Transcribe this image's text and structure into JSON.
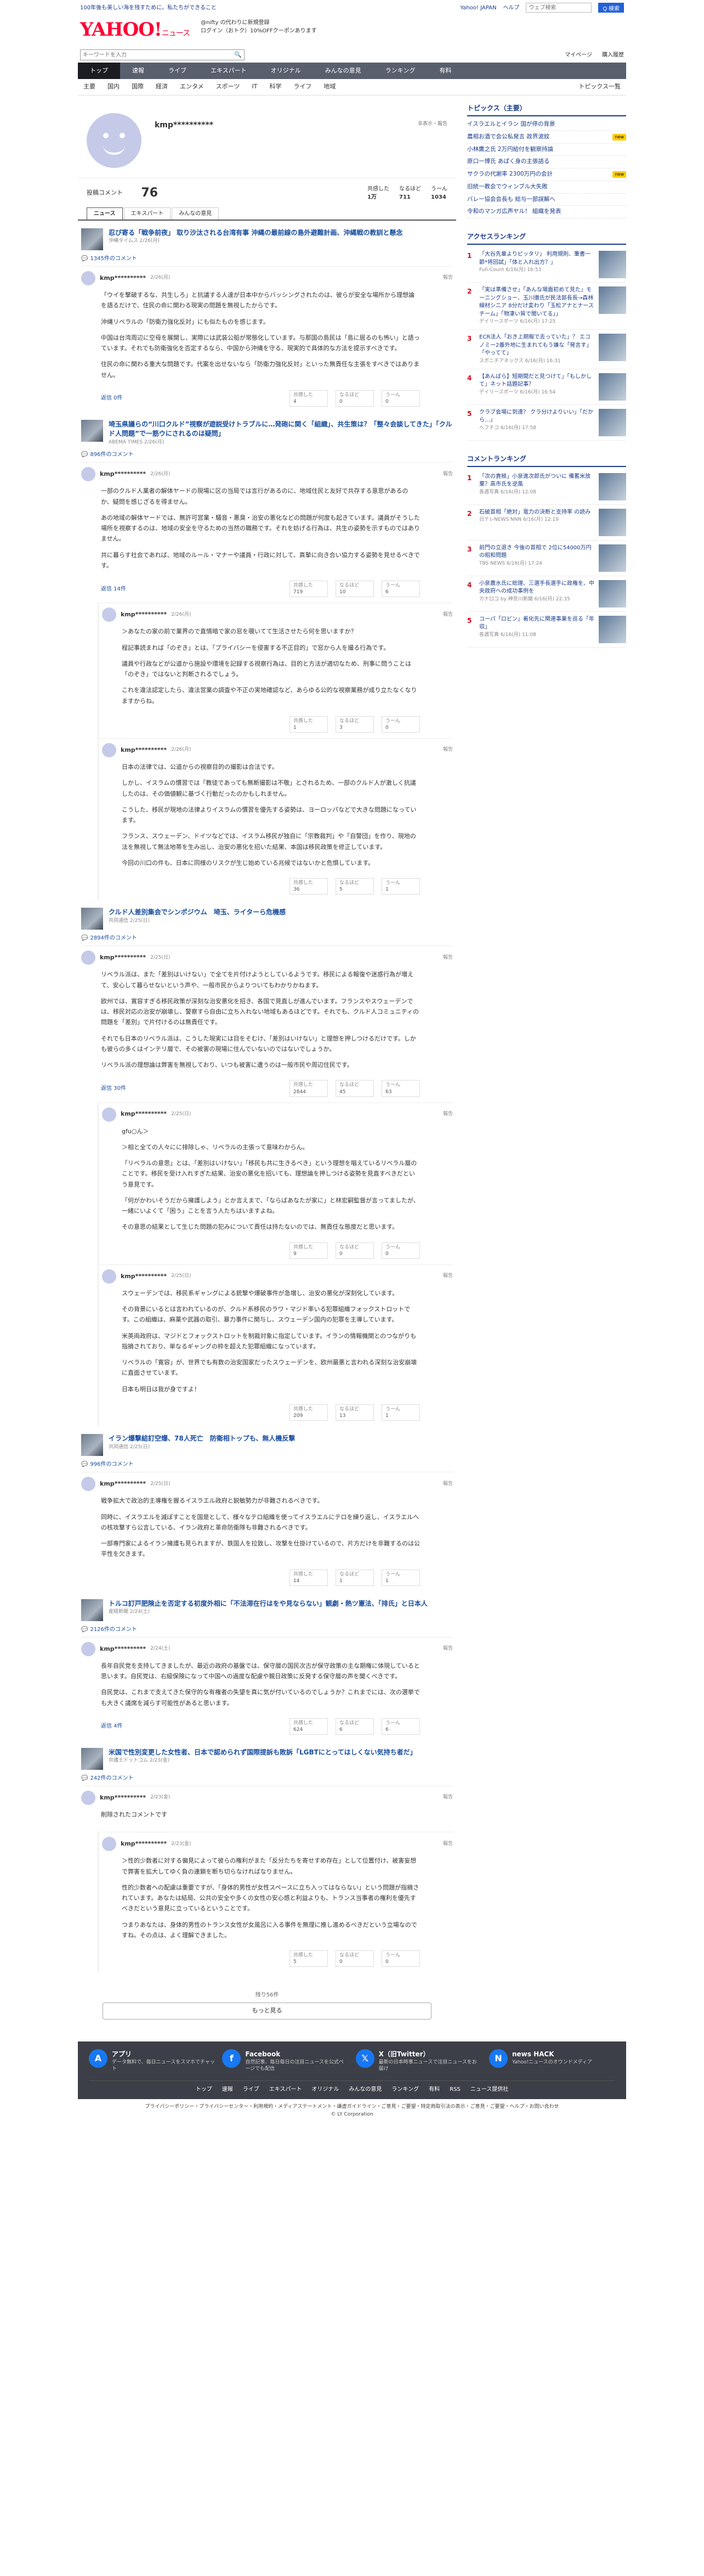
{
  "topline": {
    "left": "100年後も美しい海を残すために。私たちができること",
    "links": [
      "Yahoo! JAPAN",
      "ヘルプ"
    ],
    "search_placeholder": "ウェブ検索",
    "search_label": "Q 検索"
  },
  "logo": {
    "brand": "YAHOO!",
    "service": "ニュース",
    "sub": "JAPAN"
  },
  "promo": {
    "line1": "@nifty の代わりに新規登録",
    "line2": "ログイン（おトク）10%OFFクーポンあります"
  },
  "search": {
    "placeholder": "キーワードを入力",
    "right": [
      "マイページ",
      "購入履歴"
    ]
  },
  "nav": [
    "トップ",
    "速報",
    "ライブ",
    "エキスパート",
    "オリジナル",
    "みんなの意見",
    "ランキング",
    "有料"
  ],
  "subnav": {
    "cats": [
      "主要",
      "国内",
      "国際",
      "経済",
      "エンタメ",
      "スポーツ",
      "IT",
      "科学",
      "ライフ",
      "地域"
    ],
    "right": "トピックス一覧"
  },
  "profile": {
    "name": "kmp**********",
    "action": "非表示・報告",
    "label": "投稿コメント",
    "count": "76",
    "stats": [
      {
        "label": "共感した",
        "value": "1万"
      },
      {
        "label": "なるほど",
        "value": "711"
      },
      {
        "label": "うーん",
        "value": "1034"
      }
    ],
    "tabs": [
      "ニュース",
      "エキスパート",
      "みんなの意見"
    ]
  },
  "articles": [
    {
      "title": "忍び寄る「戦争前夜」 取り沙汰される台湾有事 沖縄の最前線の島外避難計画、沖縄戦の教訓と懸念",
      "source": "沖縄タイムス 2/26(月)",
      "count": "1345件のコメント",
      "comments": [
        {
          "user": "kmp**********",
          "time": "2/26(月)",
          "report": "報告",
          "paras": [
            "「ウイを撃破するな、共生しろ」と抗議する人達が日本中からバッシングされたのは、彼らが安全な場所から理想論を語るだけで、住民の命に関わる現実の問題を無視したからです。",
            "沖縄リベラルの「防衛力強化反対」にも似たものを感じます。",
            "中国は台湾周辺に空母を展開し、実際には武装公船が常態化しています。与那国の島民は「島に居るのも怖い」と語っています。それでも防衛強化を否定するなら、中国から沖縄を守る、現実的で具体的な方法を提示すべきです。",
            "住民の命に関わる重大な問題です。代案を出せないなら「防衛力強化反対」といった無責任な主張をすべきではありません。"
          ],
          "reply": "返信 0件",
          "reacts": [
            "4",
            "0",
            "0"
          ]
        }
      ]
    },
    {
      "title": "埼玉県議らの“川口クルド”視察が遊説受けトラブルに…発砲に関く「組織」、共生策は？「整々会談してきた」「クルド人問題”で一筋ウにされるのは疑問」",
      "source": "ABEMA TIMES 2/26(月)",
      "count": "896件のコメント",
      "comments": [
        {
          "user": "kmp**********",
          "time": "2/26(月)",
          "report": "報告",
          "paras": [
            "一部のクルド人業者の解体ヤードの現場に区の当局では言行があるのに、地域住民と友好で共存する意思があるのか、疑問を感じざるを得ません。",
            "あの地域の解体ヤードでは、無許可営業・騒音・悪臭・治安の悪化などの問題が何度も起きています。議員がそうした場所を視察するのは、地域の安全を守るための当然の職務です。それを妨げる行為は、共生の姿勢を示すものではありません。",
            "共に暮らす社会であれば、地域のルール・マナーや議員・行政に対して、真摯に向き合い協力する姿勢を見せるべきです。"
          ],
          "reply": "返信 14件",
          "reacts": [
            "719",
            "10",
            "6"
          ]
        },
        {
          "user": "kmp**********",
          "time": "2/26(月)",
          "report": "報告",
          "sub": true,
          "paras": [
            "＞あなたの家の前で業界ので直情暗で家の窓を覗いてて生活させたら何を思いますか？",
            "程記事読まれば「のぞき」とは、「プライバシーを侵害する不正目的」で窓から人を撮る行為です。",
            "議員や行政などが公道から施設や環境を記録する視察行為は、目的と方法が適切なため、刑事に問うことは「のぞき」ではないと判断されるでしょう。",
            "これを違法認定したら、違法営業の調査や不正の実地確認など、あらゆる公的な視察業務が成り立たなくなりますからね。"
          ],
          "reacts": [
            "1",
            "3",
            "0"
          ]
        },
        {
          "user": "kmp**********",
          "time": "2/26(月)",
          "report": "報告",
          "sub": true,
          "paras": [
            "日本の法律では、公道からの視察目的の撮影は合法です。",
            "しかし、イスラムの慣習では「教徒であっても無断撮影は不敬」とされるため、一部のクルド人が激しく抗議したのは、その価値観に基づく行動だったのかもしれません。",
            "こうした、移民が現地の法律よりイスラムの慣習を優先する姿勢は、ヨーロッパなどで大きな問題になっています。",
            "フランス、スウェーデン、ドイツなどでは、イスラム移民が独自に「宗教裁判」や「自警団」を作り、現地の法を無視して無法地帯を生み出し、治安の悪化を招いた結果、本国は移民政策を修正しています。",
            "今回の川口の件も、日本に同様のリスクが生じ始めている兆候ではないかと危惧しています。"
          ],
          "reacts": [
            "36",
            "5",
            "1"
          ]
        }
      ]
    },
    {
      "title": "クルド人差別集会でシンポジウム　埼玉、ライターら危機感",
      "source": "共同通信 2/25(日)",
      "count": "2894件のコメント",
      "comments": [
        {
          "user": "kmp**********",
          "time": "2/25(日)",
          "report": "報告",
          "paras": [
            "リベラル派は、また「差別はいけない」で全てを片付けようとしているようです。移民による報復や迷惑行為が増えて、安心して暮らせないという声や、一般市民からよりついてもわかりかねます。",
            "欧州では、寛容すぎる移民政策が深刻な治安悪化を招き、各国で見直しが進んでいます。フランスやスウェーデンでは、移民対応の治安が崩壊し、警察すら自由に立ち入れない地域もあるほどです。それでも、クルド人コミュニティの問題を「差別」で片付けるのは無責任です。",
            "それでも日本のリベラル派は、こうした現実には目をそむけ、「差別はいけない」と理想を押しつけるだけです。しかも彼らの多くはインテリ層で、その被害の現場に住んでいないのではないでしょうか。",
            "リベラル派の理想論は弊害を無視しており、いつも被害に遭うのは一般市民や周辺住民です。"
          ],
          "reply": "返信 30件",
          "reacts": [
            "2844",
            "45",
            "63"
          ]
        },
        {
          "user": "kmp**********",
          "time": "2/25(日)",
          "report": "報告",
          "sub": true,
          "paras": [
            "gfu○ん＞",
            "＞相と全ての人々にに排除しゃ、リベラルの主張って意味わからん。",
            "「リベラルの意思」とは、「差別はいけない」「移民も共に生きるべき」という理想を唱えているリベラル層のことです。移民を受け入れすぎた結果、治安の悪化を招いても、理想論を押しつける姿勢を見直すべきだという意見です。",
            "「何がかわいそうだから擁護しよう」とか言えまで、「ならばあなたが家に」と林宏嗣監督が言ってましたが、一緒にいよくて「困う」ことを言う人たちはいますよね。",
            "その意思の結果として生じた問題の犯みについて責任は持たないのでは、無責任な態度だと思います。"
          ],
          "reacts": [
            "9",
            "0",
            "0"
          ]
        },
        {
          "user": "kmp**********",
          "time": "2/25(日)",
          "report": "報告",
          "sub": true,
          "paras": [
            "スウェーデンでは、移民系ギャングによる銃撃や爆破事件が急増し、治安の悪化が深刻化しています。",
            "その背景にいるとは言われているのが、クルド系移民のラワ・マジド率いる犯罪組織フォックストロットです。この組織は、麻薬や武器の取引、暴力事件に関与し、スウェーデン国内の犯罪を主導しています。",
            "米英両政府は、マジドとフォックストロットを制裁対象に指定しています。イランの情報機関とのつながりも指摘されており、単なるギャングの枠を超えた犯罪組織になっています。",
            "リベラルの「寛容」が、世界でも有数の治安国家だったスウェーデンを、欧州最悪と言われる深刻な治安崩壊に直面させています。",
            "日本も明日は我が身ですよ！"
          ],
          "reacts": [
            "209",
            "13",
            "1"
          ]
        }
      ]
    },
    {
      "title": "イラン爆撃結訂空爆、78人死亡　防衛相トップも、無人機反撃",
      "source": "共同通信 2/25(日)",
      "count": "996件のコメント",
      "comments": [
        {
          "user": "kmp**********",
          "time": "2/25(日)",
          "report": "報告",
          "paras": [
            "戦争拡大で政治的主導権を握るイスラエル政府と鋭敏勢力が非難されるべきです。",
            "同時に、イスラエルを滅ぼすことを国是として、様々なテロ組織を使ってイスラエルにテロを繰り返し、イスラエルへの核攻撃すら公言している、イラン政府と革命防衛隊も非難されるべきです。",
            "一部専門家によるイラン擁護も見られますが、鉄国人を拉致し、攻撃を仕掛けているので、片方だけを非難するのは公平性を欠きます。"
          ],
          "reacts": [
            "14",
            "1",
            "1"
          ]
        }
      ]
    },
    {
      "title": "トルコ訂戸肥険止を否定する初度外相に「不法滞在行はをや見ならない」観劇・熱ツ憲法、「排氏」と日本人",
      "source": "産経新聞 2/24(土)",
      "count": "2126件のコメント",
      "comments": [
        {
          "user": "kmp**********",
          "time": "2/24(土)",
          "report": "報告",
          "paras": [
            "長年自民党を支持してきましたが、最近の政府の基盤では、保守層の国民次古が保守政策の主な期権に体現していると思います。自民党は、右級保険になって中国への過度な配慮や親日政策に反発する保守層の声を聞くべきです。",
            "自民党は、これまで支えてきた保守的な有権者の失望を真に気が付いているのでしょうか？これまでには、次の選挙でも大きく議席を減らす可能性があると思います。"
          ],
          "reply": "返信 4件",
          "reacts": [
            "624",
            "6",
            "6"
          ]
        }
      ]
    },
    {
      "title": "米国で性別変更した女性者、日本で認められず国際提訴も敗訴「LGBTにとってはしくない気持ち者だ」",
      "source": "弁護士ドットコム 2/23(金)",
      "count": "242件のコメント",
      "comments": [
        {
          "user": "kmp**********",
          "time": "2/23(金)",
          "report": "報告",
          "note": "削除されたコメントです",
          "paras": []
        },
        {
          "user": "kmp**********",
          "time": "2/23(金)",
          "report": "報告",
          "sub": true,
          "paras": [
            "＞性的少数者に対する偏見によって彼らの権利がまた「反分たちを寄せすめ存在」として位置付け、被害妄想で弊害を拡大してゆく負の連鎖を断ち切らなければなりません。",
            "性的少数者への配慮は重要ですが、「身体的男性が女性スペースに立ち入ってはならない」という問題が指摘されています。あなたは結局、公共の安全や多くの女性の安心感と利益よりも、トランス当事者の権利を優先すべきだという意見に立っているということです。",
            "つまりあなたは、身体的男性のトランス女性が女風呂に入る事件を無理に推し進めるべきだという立場なのですね。その点は、よく理解できました。"
          ],
          "reacts": [
            "5",
            "0",
            "0"
          ]
        }
      ]
    }
  ],
  "more": {
    "info": "残り56件",
    "label": "もっと見る"
  },
  "topics": {
    "title": "トピックス（主要）",
    "items": [
      {
        "t": "イスラエルとイラン 国が停の背景",
        "b": ""
      },
      {
        "t": "農相お酒で会公私発言 政界波紋",
        "b": "new"
      },
      {
        "t": "小林鷹之氏 2万円給付を観察持論",
        "b": ""
      },
      {
        "t": "原口一博氏 あぱく身の主張語る",
        "b": ""
      },
      {
        "t": "サクラの代謝率 2300万円の会計",
        "b": "new"
      },
      {
        "t": "旧統一教会でウィンブル大失敗",
        "b": ""
      },
      {
        "t": "バレー協会会長も 総与一部誤解へ",
        "b": ""
      },
      {
        "t": "令和のマンガ広声ヤル！ 組織を発表",
        "b": ""
      }
    ]
  },
  "access": {
    "title": "アクセスランキング",
    "items": [
      {
        "t": "「大谷先輩よりピッタリ」 利用規則、筆書一節*将回試」「体と入れ出方？」",
        "m": "Full-Count 6/16(月) 16:53"
      },
      {
        "t": "「実は準備させ」「あんな場面初めて見た」モーニングショー、玉川徹氏が民法部長長→森林線材シニア 8分だけ変わり「玉松アナとナースチーム」「物凄い質で聞いてる」」",
        "m": "デイリースポーツ 6/16(月) 17:25"
      },
      {
        "t": "ECR法人「おき上期報で去っていた」？ エコノミー2番外地に生まれてもう嫌な「発言す」「やってて」",
        "m": "スポニチアネックス 6/16(月) 16:31"
      },
      {
        "t": "【あんばら】短期間だと見つけて」「もしかして」ネット話題記事？",
        "m": "デイリースポーツ 6/16(月) 16:54"
      },
      {
        "t": "クラブ会場に到達？ クラ分けよりいい」「だから…」",
        "m": "ヘフチコ 6/16(月) 17:58"
      }
    ]
  },
  "commentrank": {
    "title": "コメントランキング",
    "items": [
      {
        "t": "「次の責極」小泉進次郎氏がついに 備蓄米放棄？高市氏を逆風",
        "m": "各週写真 6/16(月) 12:08"
      },
      {
        "t": "石破首相「絶対」電力の決断と支持率 の読み",
        "m": "日テレNEWS NNN 6/16(月) 12:19"
      },
      {
        "t": "前門の立退き 今後の首相で 2位に54000万円の昭和問題",
        "m": "TBS NEWS 6/16(月) 17:24"
      },
      {
        "t": "小泉農水氏に総理、三選手長選手に政権を、中央政府への成功事例を",
        "m": "カナロコ by 神奈川新聞 6/16(月) 22:35"
      },
      {
        "t": "コーパ「ロビン」着化先に関連事業を巡る「年収」",
        "m": "各週写真 6/16(月) 11:08"
      }
    ]
  },
  "footer": {
    "blocks": [
      {
        "title": "アプリ",
        "desc": "データ無料で、毎日ニュースをスマホでチャット"
      },
      {
        "title": "Facebook",
        "desc": "自然記事、毎日毎日の注目ニュースを公式ページでも配信"
      },
      {
        "title": "X（旧Twitter）",
        "desc": "最新の日本時事ニュースで注目ニュースをお届け"
      },
      {
        "title": "news HACK",
        "desc": "Yahoo!ニュースのオウンドメディア"
      }
    ],
    "links": [
      "トップ",
      "速報",
      "ライブ",
      "エキスパート",
      "オリジナル",
      "みんなの意見",
      "ランキング",
      "有料",
      "RSS",
      "ニュース提供社"
    ],
    "legal": "プライバシーポリシー・プライバシーセンター・利用規約・メディアステートメント・謙虚ガイドライン・ご意見・ご要望・特定商取引法の表示・ご意見・ご要望・ヘルプ・お問い合わせ",
    "copy": "© LY Corporation"
  },
  "colors": {
    "accent": "#1a3b8a",
    "brand": "#ff0033",
    "nav": "#585f6d"
  }
}
